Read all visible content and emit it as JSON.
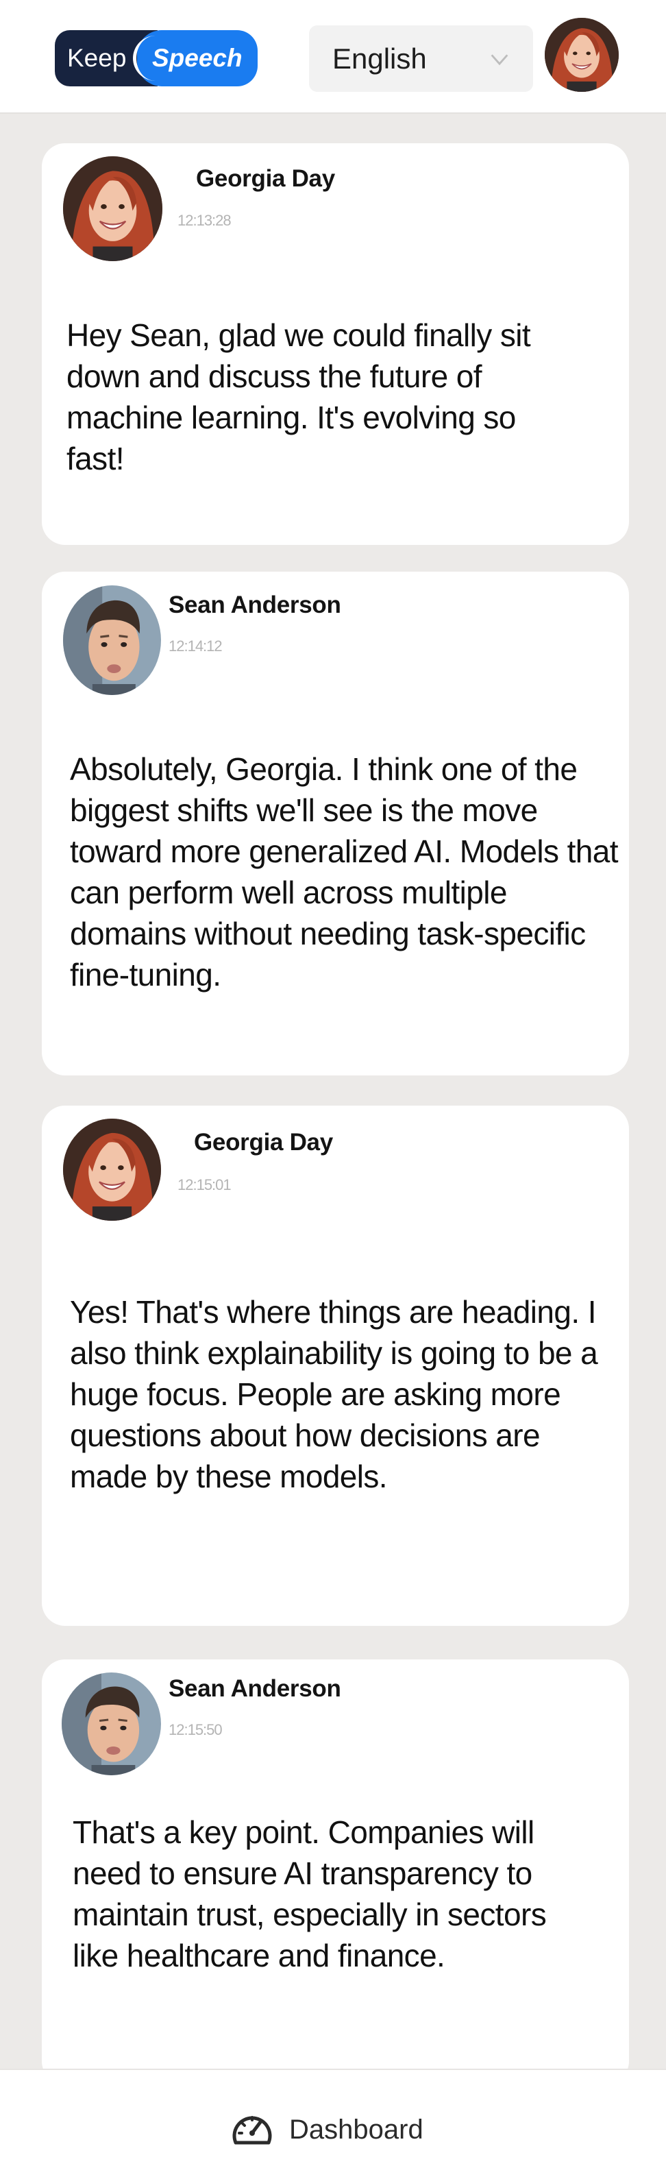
{
  "app": {
    "logo_part1": "Keep",
    "logo_part2": "Speech"
  },
  "header": {
    "language_selected": "English",
    "avatar_icon": "user-avatar-georgia"
  },
  "messages": [
    {
      "sender": "Georgia Day",
      "time": "12:13:28",
      "text": "Hey Sean, glad we could finally sit down and discuss the future of machine learning. It's evolving so fast!",
      "avatar": "georgia-avatar-icon"
    },
    {
      "sender": "Sean Anderson",
      "time": "12:14:12",
      "text": "Absolutely, Georgia. I think one of the biggest shifts we'll see is the move toward more generalized AI. Models that can perform well across multiple domains without needing task-specific fine-tuning.",
      "avatar": "sean-avatar-icon"
    },
    {
      "sender": "Georgia Day",
      "time": "12:15:01",
      "text": "Yes! That's where things are heading. I also think explainability is going to be a huge focus. People are asking more questions about how decisions are made by these models.",
      "avatar": "georgia-avatar-icon"
    },
    {
      "sender": "Sean Anderson",
      "time": "12:15:50",
      "text": "That's a key point. Companies will need to ensure AI transparency to maintain trust, especially in sectors like healthcare and finance.",
      "avatar": "sean-avatar-icon"
    }
  ],
  "bottom_nav": {
    "dashboard_label": "Dashboard",
    "dashboard_icon": "speedometer-icon"
  },
  "colors": {
    "background": "#eceae8",
    "brand_dark": "#17233f",
    "brand_blue": "#1a7cf0",
    "card": "#ffffff"
  }
}
